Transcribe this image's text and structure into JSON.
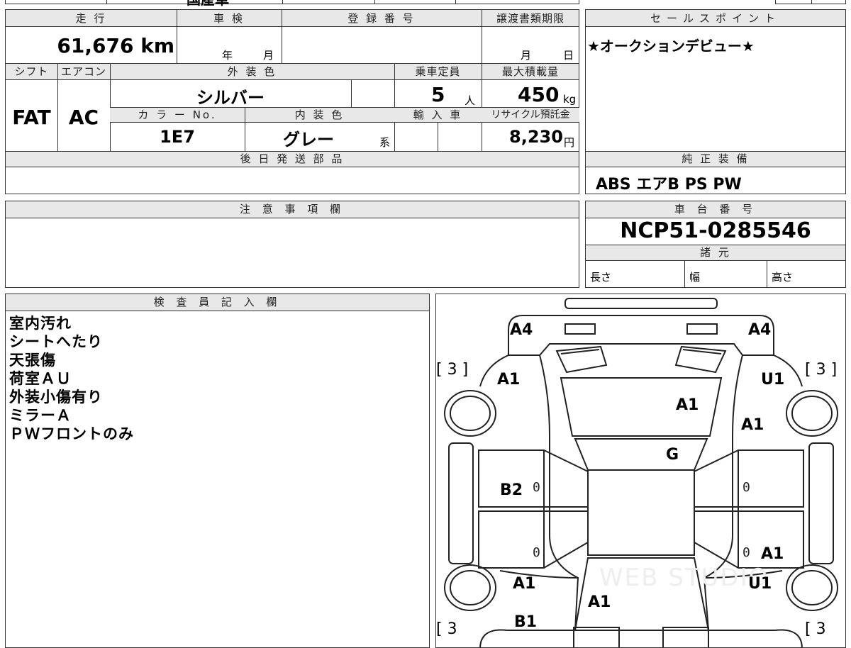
{
  "top_row": {
    "partial_text": "国産車"
  },
  "main": {
    "mileage_header": "走 行",
    "inspection_header": "車 検",
    "registration_header": "登 録 番 号",
    "transfer_header": "譲渡書類期限",
    "mileage_value": "61,676 km",
    "inspection_year": "年",
    "inspection_month": "月",
    "transfer_month": "月",
    "transfer_day": "日",
    "shift_header": "シフト",
    "ac_header": "エアコン",
    "exterior_color_header": "外 装 色",
    "capacity_header": "乗車定員",
    "max_load_header": "最大積載量",
    "shift_value": "FAT",
    "ac_value": "AC",
    "exterior_color_value": "シルバー",
    "capacity_value": "5",
    "capacity_unit": "人",
    "max_load_value": "450",
    "max_load_unit": "kg",
    "color_no_header": "カ ラ ー No.",
    "interior_color_header": "内 装 色",
    "import_header": "輸 入 車",
    "recycle_header": "リサイクル預託金",
    "color_no_value": "1E7",
    "interior_color_value": "グレー",
    "interior_color_suffix": "系",
    "recycle_value": "8,230",
    "recycle_unit": "円",
    "later_parts_header": "後 日 発 送 部 品",
    "notes_header": "注 意 事 項 欄",
    "inspector_header": "検 査 員 記 入 欄",
    "inspector_notes": [
      "室内汚れ",
      "シートへたり",
      "天張傷",
      "荷室ＡＵ",
      "外装小傷有り",
      "ミラーＡ",
      "ＰＷフロントのみ"
    ]
  },
  "sidebar": {
    "sales_point_header": "セールスポイント",
    "sales_point_text": "★オークションデビュー★",
    "equipment_header": "純 正 装 備",
    "equipment_text": "ABS エアB PS PW",
    "chassis_header": "車 台 番 号",
    "chassis_value": "NCP51-0285546",
    "specs_header": "諸 元",
    "length_label": "長さ",
    "width_label": "幅",
    "height_label": "高さ"
  },
  "diagram": {
    "marks": {
      "rear_left": "A4",
      "rear_right": "A4",
      "rear_left_quarter": "A1",
      "rear_right_quarter": "U1",
      "roof": "A1",
      "right_rear_door": "A1",
      "windshield": "G",
      "left_rear_door": "B2",
      "right_front_door": "A1",
      "left_front_fender": "A1",
      "right_front_fender": "U1",
      "hood": "A1",
      "front_bumper": "B1"
    },
    "tread_left_rear": "[ 3 ]",
    "tread_right_rear": "[ 3 ]",
    "tread_left_front": "[ 3",
    "tread_right_front": "[ 3",
    "zero": "0",
    "watermark": "WEB STUDIO"
  }
}
